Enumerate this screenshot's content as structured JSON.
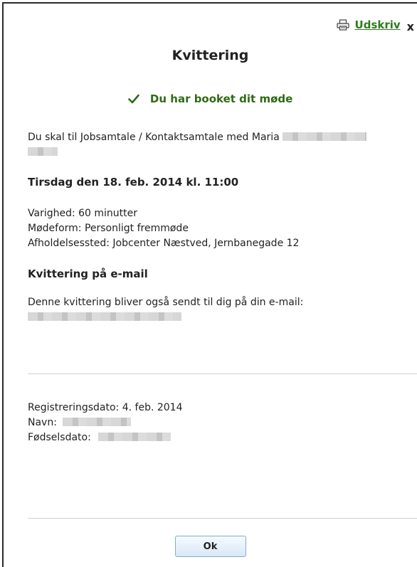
{
  "toolbar": {
    "print_label": "Udskriv",
    "close_label": "x",
    "print_icon": "printer-icon"
  },
  "title": "Kvittering",
  "success": {
    "icon": "checkmark-icon",
    "message": "Du har booket dit møde",
    "color": "#2f6b16"
  },
  "booking": {
    "intro": "Du skal til Jobsamtale / Kontaktsamtale med Maria",
    "datetime": "Tirsdag den 18. feb. 2014 kl. 11:00",
    "duration": "Varighed: 60 minutter",
    "meeting_form": "Mødeform: Personligt fremmøde",
    "location": "Afholdelsessted: Jobcenter Næstved, Jernbanegade 12"
  },
  "email_section": {
    "heading": "Kvittering på e-mail",
    "text": "Denne kvittering bliver også sendt til dig på din e-mail:"
  },
  "registration": {
    "date": "Registreringsdato: 4. feb. 2014",
    "name_label": "Navn:",
    "birthdate_label": "Fødselsdato:"
  },
  "footer": {
    "ok_label": "Ok"
  }
}
